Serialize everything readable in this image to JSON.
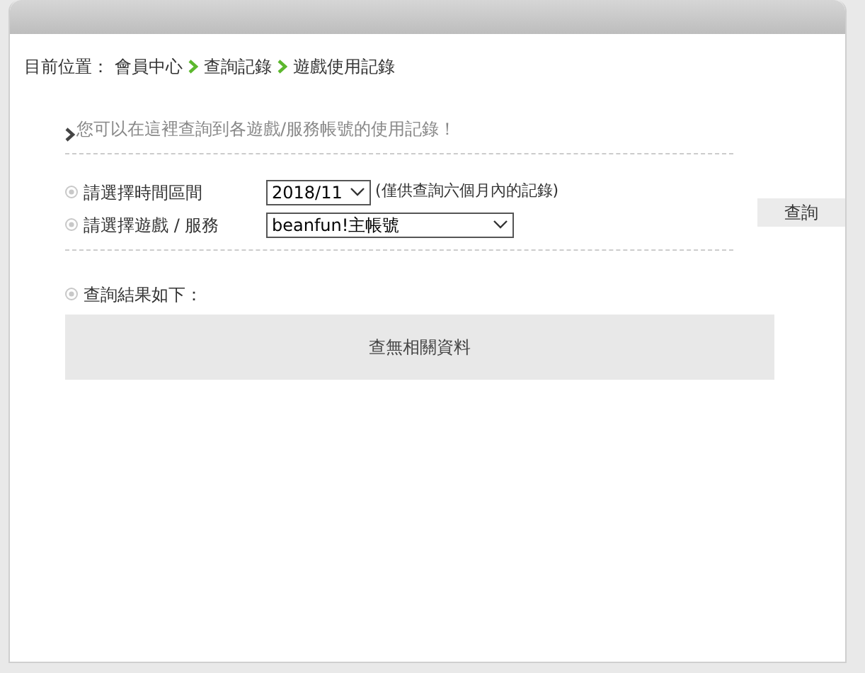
{
  "breadcrumb": {
    "label": "目前位置：",
    "items": [
      "會員中心",
      "查詢記錄",
      "遊戲使用記錄"
    ]
  },
  "intro": "您可以在這裡查詢到各遊戲/服務帳號的使用記錄！",
  "form": {
    "period_label": "請選擇時間區間",
    "period_value": "2018/11",
    "period_note": "(僅供查詢六個月內的記錄)",
    "game_label": "請選擇遊戲 / 服務",
    "game_value": "beanfun!主帳號",
    "query_button": "查詢"
  },
  "results": {
    "label": "查詢結果如下：",
    "empty_message": "查無相關資料"
  }
}
